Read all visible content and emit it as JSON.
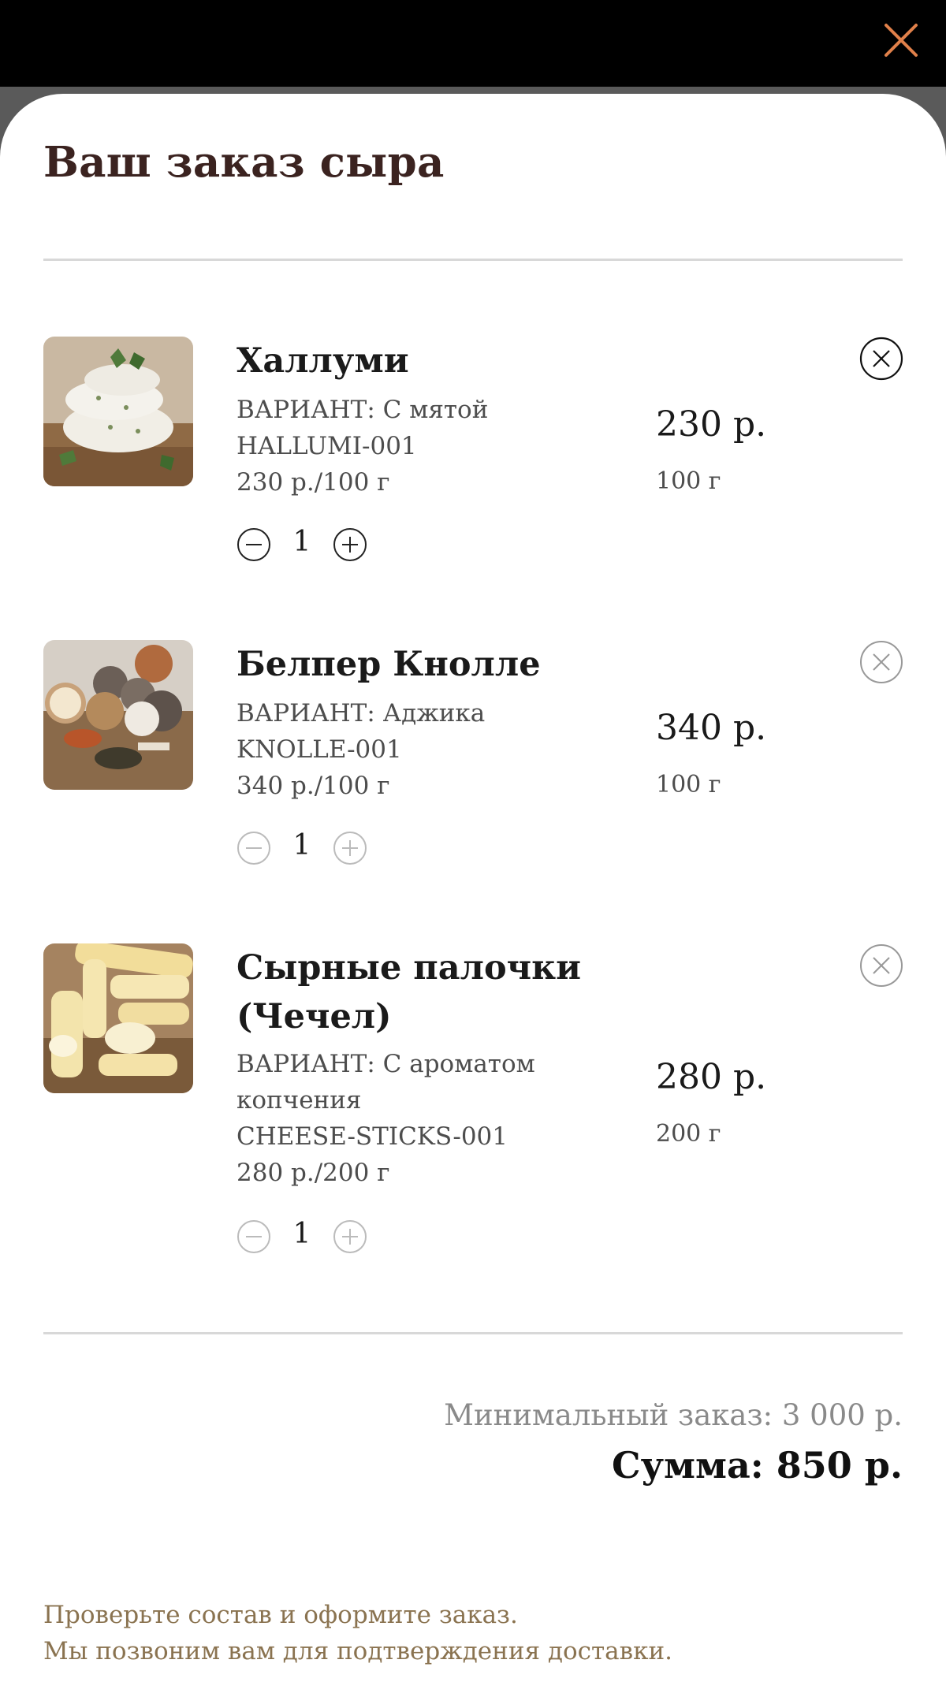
{
  "modal": {
    "close_icon": "close-icon",
    "title": "Ваш заказ сыра"
  },
  "colors": {
    "accent": "#e0804a",
    "title": "#3b2320",
    "footnote": "#8a7350"
  },
  "items": [
    {
      "name": "Халлуми",
      "variant": "ВАРИАНТ: С мятой",
      "sku": "HALLUMI-001",
      "unit_price": "230 р./100 г",
      "price": "230 р.",
      "weight": "100 г",
      "quantity": "1",
      "image": "halloumi-with-mint-photo"
    },
    {
      "name": "Белпер Кнолле",
      "variant": "ВАРИАНТ: Аджика",
      "sku": "KNOLLE-001",
      "unit_price": "340 р./100 г",
      "price": "340 р.",
      "weight": "100 г",
      "quantity": "1",
      "image": "belper-knolle-cheese-balls-photo"
    },
    {
      "name_line1": "Сырные палочки",
      "name_line2": "(Чечел)",
      "variant_line1": "ВАРИАНТ: С ароматом",
      "variant_line2": "копчения",
      "sku": "CHEESE-STICKS-001",
      "unit_price": "280 р./200 г",
      "price": "280 р.",
      "weight": "200 г",
      "quantity": "1",
      "image": "smoked-cheese-sticks-photo"
    }
  ],
  "summary": {
    "min_order": "Минимальный заказ: 3 000 р.",
    "total": "Сумма: 850 р."
  },
  "footer": {
    "line1": "Проверьте состав и оформите заказ.",
    "line2": "Мы позвоним вам для подтверждения доставки."
  }
}
